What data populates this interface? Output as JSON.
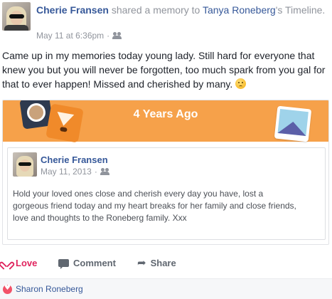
{
  "post": {
    "author": "Cherie Fransen",
    "action_text": " shared a memory to ",
    "target": "Tanya Roneberg",
    "target_suffix": "'s Timeline.",
    "timestamp": "May 11 at 6:36pm",
    "separator": " · ",
    "audience_icon": "friends-icon",
    "text": "Came up in my memories today young lady. Still hard for everyone that knew you but you will never be forgotten, too much spark from you gal for that to ever happen! Missed and cherished by many.",
    "emoji": "sad-face-emoji"
  },
  "memory": {
    "banner_title": "4 Years Ago",
    "banner_color": "#f6a14a",
    "original_post": {
      "author": "Cherie Fransen",
      "timestamp": "May 11, 2013",
      "separator": " · ",
      "text": "Hold your loved ones close and cherish every day you have, lost a gorgeous friend today and my heart breaks for her family and close friends, love and thoughts to the Roneberg family. Xxx"
    }
  },
  "actions": {
    "love_label": "Love",
    "comment_label": "Comment",
    "share_label": "Share"
  },
  "reactions": {
    "names": "Sharon Roneberg",
    "love_color": "#f25268"
  },
  "colors": {
    "link": "#365899",
    "meta": "#90949c",
    "love": "#e0245e"
  }
}
